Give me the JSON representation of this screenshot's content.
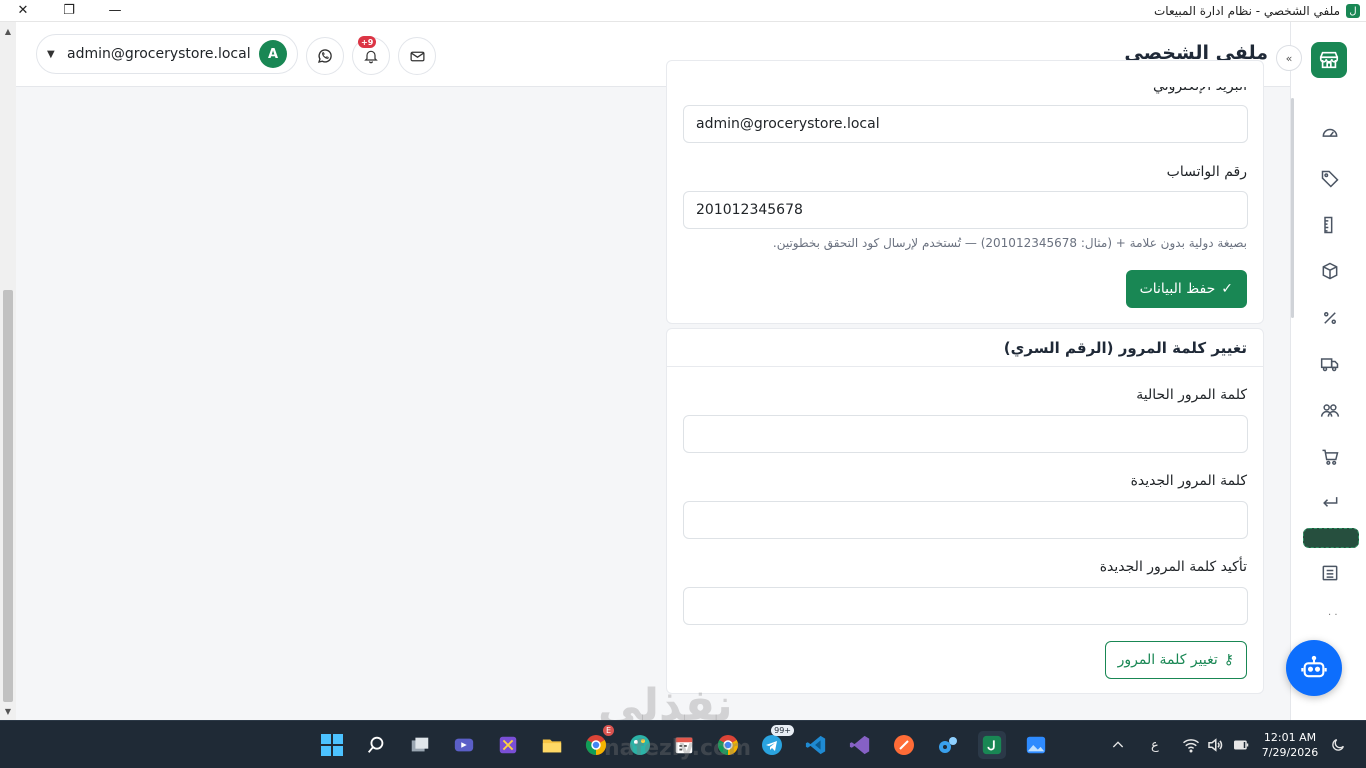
{
  "window": {
    "title": "ملفي الشخصي - نظام ادارة المبيعات",
    "app_icon_glyph": "ل",
    "minimize_glyph": "—",
    "restore_glyph": "❐",
    "close_glyph": "✕"
  },
  "header": {
    "page_title": "ملفي الشخصي",
    "user_email": "admin@grocerystore.local",
    "avatar_letter": "A",
    "notification_badge": "+9"
  },
  "profile_form": {
    "email_label": "البريد الإلكتروني",
    "email_value": "admin@grocerystore.local",
    "whatsapp_label": "رقم الواتساب",
    "whatsapp_value": "201012345678",
    "whatsapp_hint": "بصيغة دولية بدون علامة + (مثال: 201012345678) — تُستخدم لإرسال كود التحقق بخطوتين.",
    "save_button": "حفظ البيانات",
    "save_icon": "✓"
  },
  "password_form": {
    "title": "تغيير كلمة المرور (الرقم السري)",
    "current_label": "كلمة المرور الحالية",
    "new_label": "كلمة المرور الجديدة",
    "confirm_label": "تأكيد كلمة المرور الجديدة",
    "submit_button": "تغيير كلمة المرور",
    "key_icon": "⚷"
  },
  "watermark": {
    "arabic": "نفذلي",
    "latin": "nafezly.com"
  },
  "taskbar": {
    "chrome_badge": "E",
    "telegram_badge": "99+",
    "lang_indicator": "ع",
    "time": "12:01 AM",
    "date": "7/29/2026"
  },
  "colors": {
    "primary": "#198754",
    "bot_button": "#0d6efd",
    "badge": "#dc3545"
  }
}
